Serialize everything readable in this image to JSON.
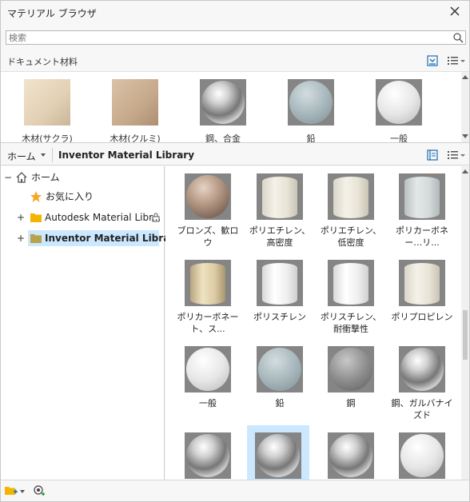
{
  "window": {
    "title": "マテリアル ブラウザ"
  },
  "search": {
    "value": "検索",
    "placeholder": "検索"
  },
  "document": {
    "label": "ドキュメント材料",
    "items": [
      {
        "label": "木材(サクラ)",
        "look": "cube-a"
      },
      {
        "label": "木材(クルミ)",
        "look": "cube-b"
      },
      {
        "label": "鋼、合金",
        "look": "chrome"
      },
      {
        "label": "鉛",
        "look": "blue-sphere"
      },
      {
        "label": "一般",
        "look": "white-sphere"
      }
    ]
  },
  "library_toolbar": {
    "home": "ホーム",
    "library": "Inventor Material Library"
  },
  "tree": {
    "home": "ホーム",
    "favorites": "お気に入り",
    "autodesk": "Autodesk Material Libr...",
    "inventor": "Inventor Material Library"
  },
  "materials": [
    {
      "label": "ブロンズ、歓ロウ",
      "look": "bronze"
    },
    {
      "label": "ポリエチレン、高密度",
      "look": "cream-cylinder"
    },
    {
      "label": "ポリエチレン、低密度",
      "look": "cream-cylinder"
    },
    {
      "label": "ポリカーボネー…リ...",
      "look": "clear-cylinder"
    },
    {
      "label": "ポリカーボネート、ス...",
      "look": "amber-cylinder"
    },
    {
      "label": "ポリスチレン",
      "look": "white-cylinder"
    },
    {
      "label": "ポリスチレン、耐衝撃性",
      "look": "white-cylinder"
    },
    {
      "label": "ポリプロピレン",
      "look": "cream-cylinder"
    },
    {
      "label": "一般",
      "look": "white-sphere"
    },
    {
      "label": "鉛",
      "look": "blue-sphere"
    },
    {
      "label": "鋼",
      "look": "steel-sphere"
    },
    {
      "label": "鋼、ガルバナイズド",
      "look": "chrome"
    },
    {
      "label": "",
      "look": "chrome"
    },
    {
      "label": "",
      "look": "chrome"
    },
    {
      "label": "",
      "look": "chrome"
    },
    {
      "label": "",
      "look": "white-sphere"
    }
  ],
  "colors": {
    "selection": "#cce8ff",
    "folder": "#f5b400",
    "star": "#f5a623"
  }
}
